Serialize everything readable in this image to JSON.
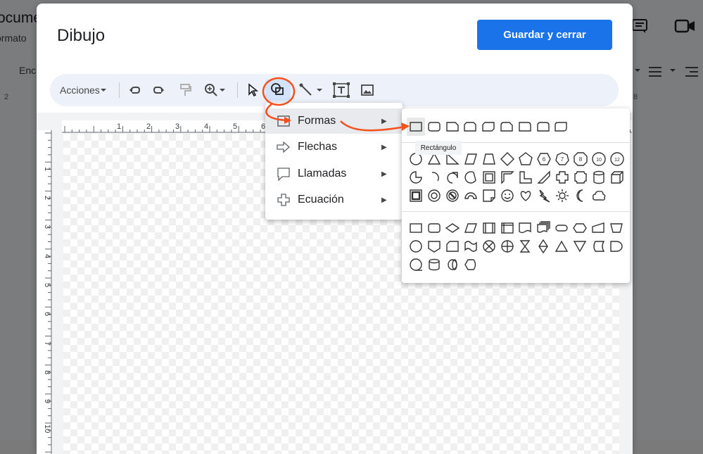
{
  "background_doc": {
    "title_fragment": "ocume",
    "menu_fragment": "ormato",
    "toolbar_fragment": "Enc",
    "ruler_left": "2",
    "ruler_right": "8"
  },
  "dialog": {
    "title": "Dibujo",
    "save_button": "Guardar y cerrar"
  },
  "toolbar": {
    "actions_label": "Acciones"
  },
  "ruler": {
    "top_numbers": [
      "1",
      "2",
      "3",
      "4",
      "5",
      "6"
    ],
    "left_numbers": [
      "1",
      "2",
      "3",
      "4",
      "5",
      "6",
      "7",
      "8",
      "9",
      "10"
    ]
  },
  "shape_menu": {
    "items": [
      {
        "label": "Formas",
        "icon": "shapes-icon"
      },
      {
        "label": "Flechas",
        "icon": "arrow-icon"
      },
      {
        "label": "Llamadas",
        "icon": "callout-icon"
      },
      {
        "label": "Ecuación",
        "icon": "plus-icon"
      }
    ],
    "arrow": "▶"
  },
  "tooltip": "Rectángulo",
  "colors": {
    "accent": "#1a73e8",
    "annotation": "#f4511e",
    "toolbar_bg": "#edf2fa",
    "active_bg": "#d3e3fd"
  }
}
